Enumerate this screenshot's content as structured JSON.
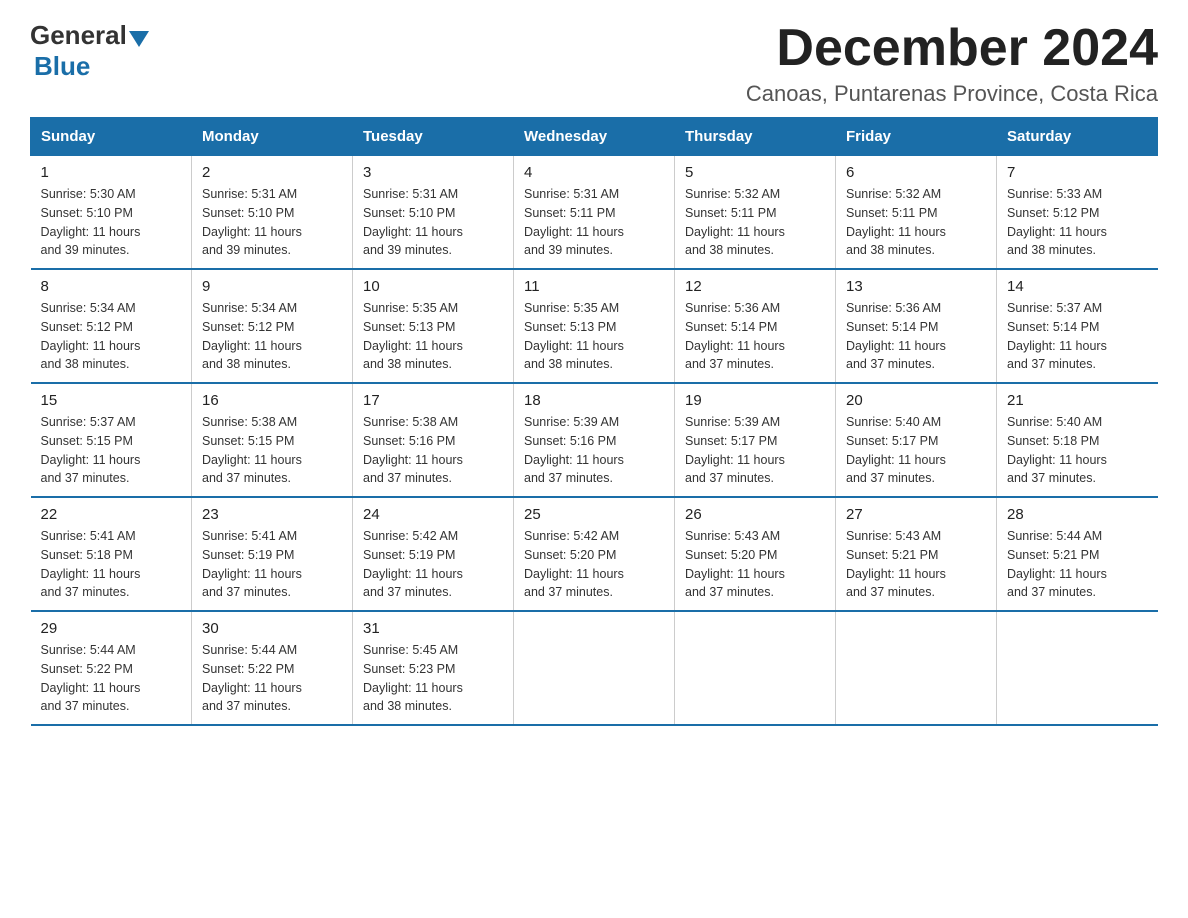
{
  "header": {
    "logo_general": "General",
    "logo_blue": "Blue",
    "month_title": "December 2024",
    "location": "Canoas, Puntarenas Province, Costa Rica"
  },
  "weekdays": [
    "Sunday",
    "Monday",
    "Tuesday",
    "Wednesday",
    "Thursday",
    "Friday",
    "Saturday"
  ],
  "weeks": [
    [
      {
        "day": "1",
        "sunrise": "5:30 AM",
        "sunset": "5:10 PM",
        "daylight": "11 hours and 39 minutes."
      },
      {
        "day": "2",
        "sunrise": "5:31 AM",
        "sunset": "5:10 PM",
        "daylight": "11 hours and 39 minutes."
      },
      {
        "day": "3",
        "sunrise": "5:31 AM",
        "sunset": "5:10 PM",
        "daylight": "11 hours and 39 minutes."
      },
      {
        "day": "4",
        "sunrise": "5:31 AM",
        "sunset": "5:11 PM",
        "daylight": "11 hours and 39 minutes."
      },
      {
        "day": "5",
        "sunrise": "5:32 AM",
        "sunset": "5:11 PM",
        "daylight": "11 hours and 38 minutes."
      },
      {
        "day": "6",
        "sunrise": "5:32 AM",
        "sunset": "5:11 PM",
        "daylight": "11 hours and 38 minutes."
      },
      {
        "day": "7",
        "sunrise": "5:33 AM",
        "sunset": "5:12 PM",
        "daylight": "11 hours and 38 minutes."
      }
    ],
    [
      {
        "day": "8",
        "sunrise": "5:34 AM",
        "sunset": "5:12 PM",
        "daylight": "11 hours and 38 minutes."
      },
      {
        "day": "9",
        "sunrise": "5:34 AM",
        "sunset": "5:12 PM",
        "daylight": "11 hours and 38 minutes."
      },
      {
        "day": "10",
        "sunrise": "5:35 AM",
        "sunset": "5:13 PM",
        "daylight": "11 hours and 38 minutes."
      },
      {
        "day": "11",
        "sunrise": "5:35 AM",
        "sunset": "5:13 PM",
        "daylight": "11 hours and 38 minutes."
      },
      {
        "day": "12",
        "sunrise": "5:36 AM",
        "sunset": "5:14 PM",
        "daylight": "11 hours and 37 minutes."
      },
      {
        "day": "13",
        "sunrise": "5:36 AM",
        "sunset": "5:14 PM",
        "daylight": "11 hours and 37 minutes."
      },
      {
        "day": "14",
        "sunrise": "5:37 AM",
        "sunset": "5:14 PM",
        "daylight": "11 hours and 37 minutes."
      }
    ],
    [
      {
        "day": "15",
        "sunrise": "5:37 AM",
        "sunset": "5:15 PM",
        "daylight": "11 hours and 37 minutes."
      },
      {
        "day": "16",
        "sunrise": "5:38 AM",
        "sunset": "5:15 PM",
        "daylight": "11 hours and 37 minutes."
      },
      {
        "day": "17",
        "sunrise": "5:38 AM",
        "sunset": "5:16 PM",
        "daylight": "11 hours and 37 minutes."
      },
      {
        "day": "18",
        "sunrise": "5:39 AM",
        "sunset": "5:16 PM",
        "daylight": "11 hours and 37 minutes."
      },
      {
        "day": "19",
        "sunrise": "5:39 AM",
        "sunset": "5:17 PM",
        "daylight": "11 hours and 37 minutes."
      },
      {
        "day": "20",
        "sunrise": "5:40 AM",
        "sunset": "5:17 PM",
        "daylight": "11 hours and 37 minutes."
      },
      {
        "day": "21",
        "sunrise": "5:40 AM",
        "sunset": "5:18 PM",
        "daylight": "11 hours and 37 minutes."
      }
    ],
    [
      {
        "day": "22",
        "sunrise": "5:41 AM",
        "sunset": "5:18 PM",
        "daylight": "11 hours and 37 minutes."
      },
      {
        "day": "23",
        "sunrise": "5:41 AM",
        "sunset": "5:19 PM",
        "daylight": "11 hours and 37 minutes."
      },
      {
        "day": "24",
        "sunrise": "5:42 AM",
        "sunset": "5:19 PM",
        "daylight": "11 hours and 37 minutes."
      },
      {
        "day": "25",
        "sunrise": "5:42 AM",
        "sunset": "5:20 PM",
        "daylight": "11 hours and 37 minutes."
      },
      {
        "day": "26",
        "sunrise": "5:43 AM",
        "sunset": "5:20 PM",
        "daylight": "11 hours and 37 minutes."
      },
      {
        "day": "27",
        "sunrise": "5:43 AM",
        "sunset": "5:21 PM",
        "daylight": "11 hours and 37 minutes."
      },
      {
        "day": "28",
        "sunrise": "5:44 AM",
        "sunset": "5:21 PM",
        "daylight": "11 hours and 37 minutes."
      }
    ],
    [
      {
        "day": "29",
        "sunrise": "5:44 AM",
        "sunset": "5:22 PM",
        "daylight": "11 hours and 37 minutes."
      },
      {
        "day": "30",
        "sunrise": "5:44 AM",
        "sunset": "5:22 PM",
        "daylight": "11 hours and 37 minutes."
      },
      {
        "day": "31",
        "sunrise": "5:45 AM",
        "sunset": "5:23 PM",
        "daylight": "11 hours and 38 minutes."
      },
      null,
      null,
      null,
      null
    ]
  ],
  "labels": {
    "sunrise": "Sunrise:",
    "sunset": "Sunset:",
    "daylight": "Daylight:"
  },
  "colors": {
    "header_bg": "#1a6ea8",
    "accent": "#1a6ea8"
  }
}
